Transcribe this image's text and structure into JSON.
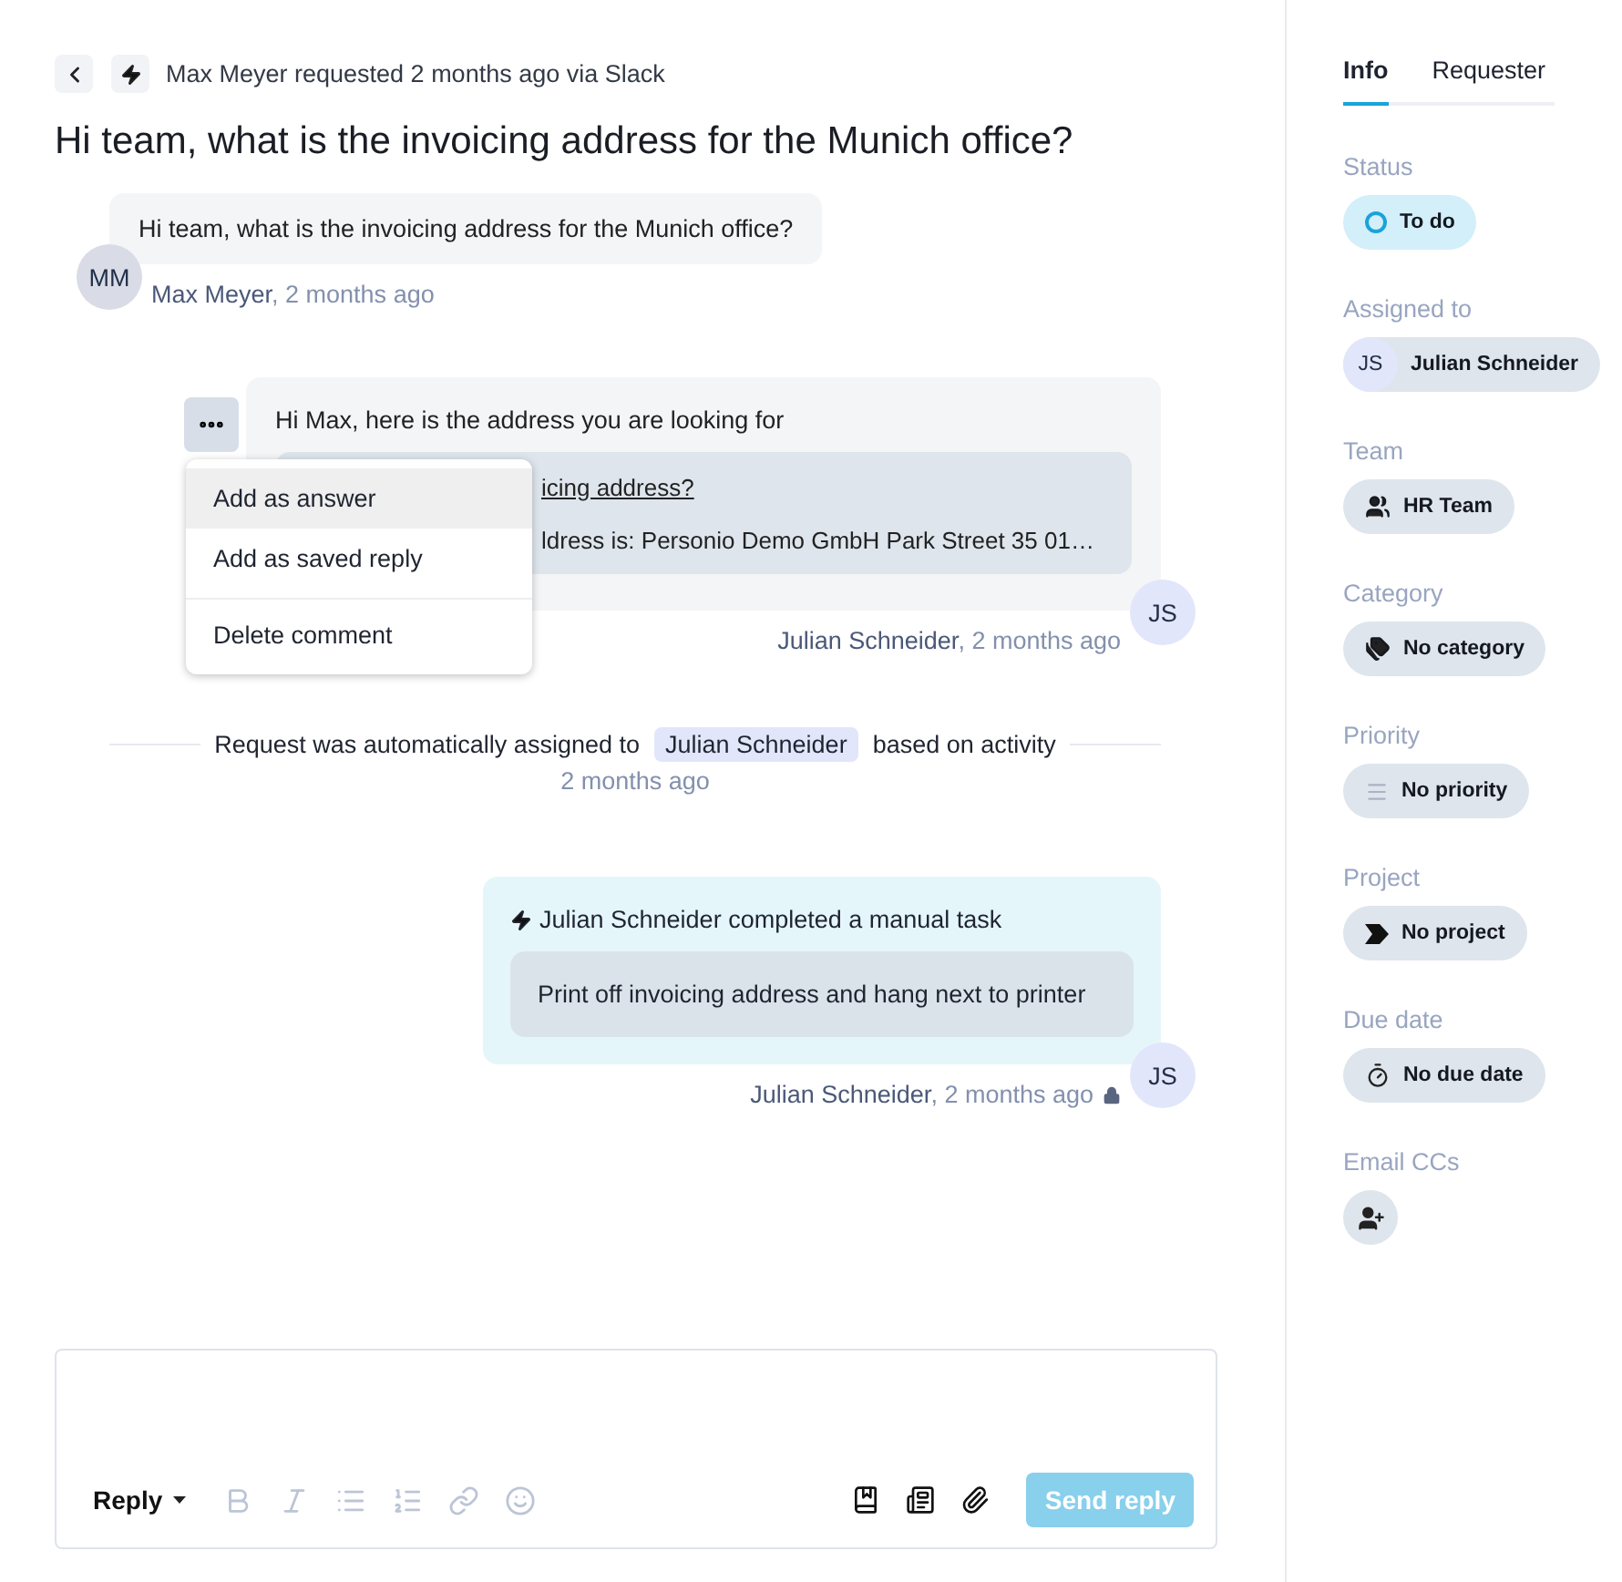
{
  "header": {
    "meta": "Max Meyer requested 2 months ago via Slack",
    "title": "Hi team, what is the invoicing address for the Munich office?"
  },
  "thread": [
    {
      "kind": "question",
      "initials": "MM",
      "text": "Hi team, what is the invoicing address for the Munich office?",
      "author": "Max Meyer",
      "time": ", 2 months ago"
    },
    {
      "kind": "reply",
      "initials": "JS",
      "text": "Hi Max, here is the address you are looking for",
      "quote": {
        "title": "icing address?",
        "body": "ldress is: Personio Demo GmbH Park Street 35 01…"
      },
      "author": "Julian Schneider",
      "time": ", 2 months ago",
      "menu": [
        {
          "label": "Add as answer",
          "selected": true,
          "divider_above": false
        },
        {
          "label": "Add as saved reply",
          "selected": false,
          "divider_above": false
        },
        {
          "label": "Delete comment",
          "selected": false,
          "divider_above": true
        }
      ]
    },
    {
      "kind": "event",
      "before": "Request was automatically assigned to",
      "person": "Julian Schneider",
      "after": "based on activity",
      "time": "2 months ago"
    },
    {
      "kind": "task",
      "initials": "JS",
      "headline": "Julian Schneider completed a manual task",
      "task": "Print off invoicing address and hang next to printer",
      "author": "Julian Schneider",
      "time": ", 2 months ago",
      "private": true
    }
  ],
  "editor": {
    "mode": "Reply",
    "send": "Send reply",
    "send_disabled": true
  },
  "sidebar": {
    "tabs": [
      {
        "label": "Info",
        "selected": true
      },
      {
        "label": "Requester",
        "selected": false
      }
    ],
    "fields": [
      {
        "label": "Status",
        "kind": "status",
        "value": "To do"
      },
      {
        "label": "Assigned to",
        "kind": "person",
        "initials": "JS",
        "value": "Julian Schneider"
      },
      {
        "label": "Team",
        "kind": "team",
        "value": "HR Team"
      },
      {
        "label": "Category",
        "kind": "category",
        "value": "No category"
      },
      {
        "label": "Priority",
        "kind": "priority",
        "value": "No priority"
      },
      {
        "label": "Project",
        "kind": "project",
        "value": "No project"
      },
      {
        "label": "Due date",
        "kind": "due",
        "value": "No due date"
      },
      {
        "label": "Email CCs",
        "kind": "add"
      }
    ]
  }
}
